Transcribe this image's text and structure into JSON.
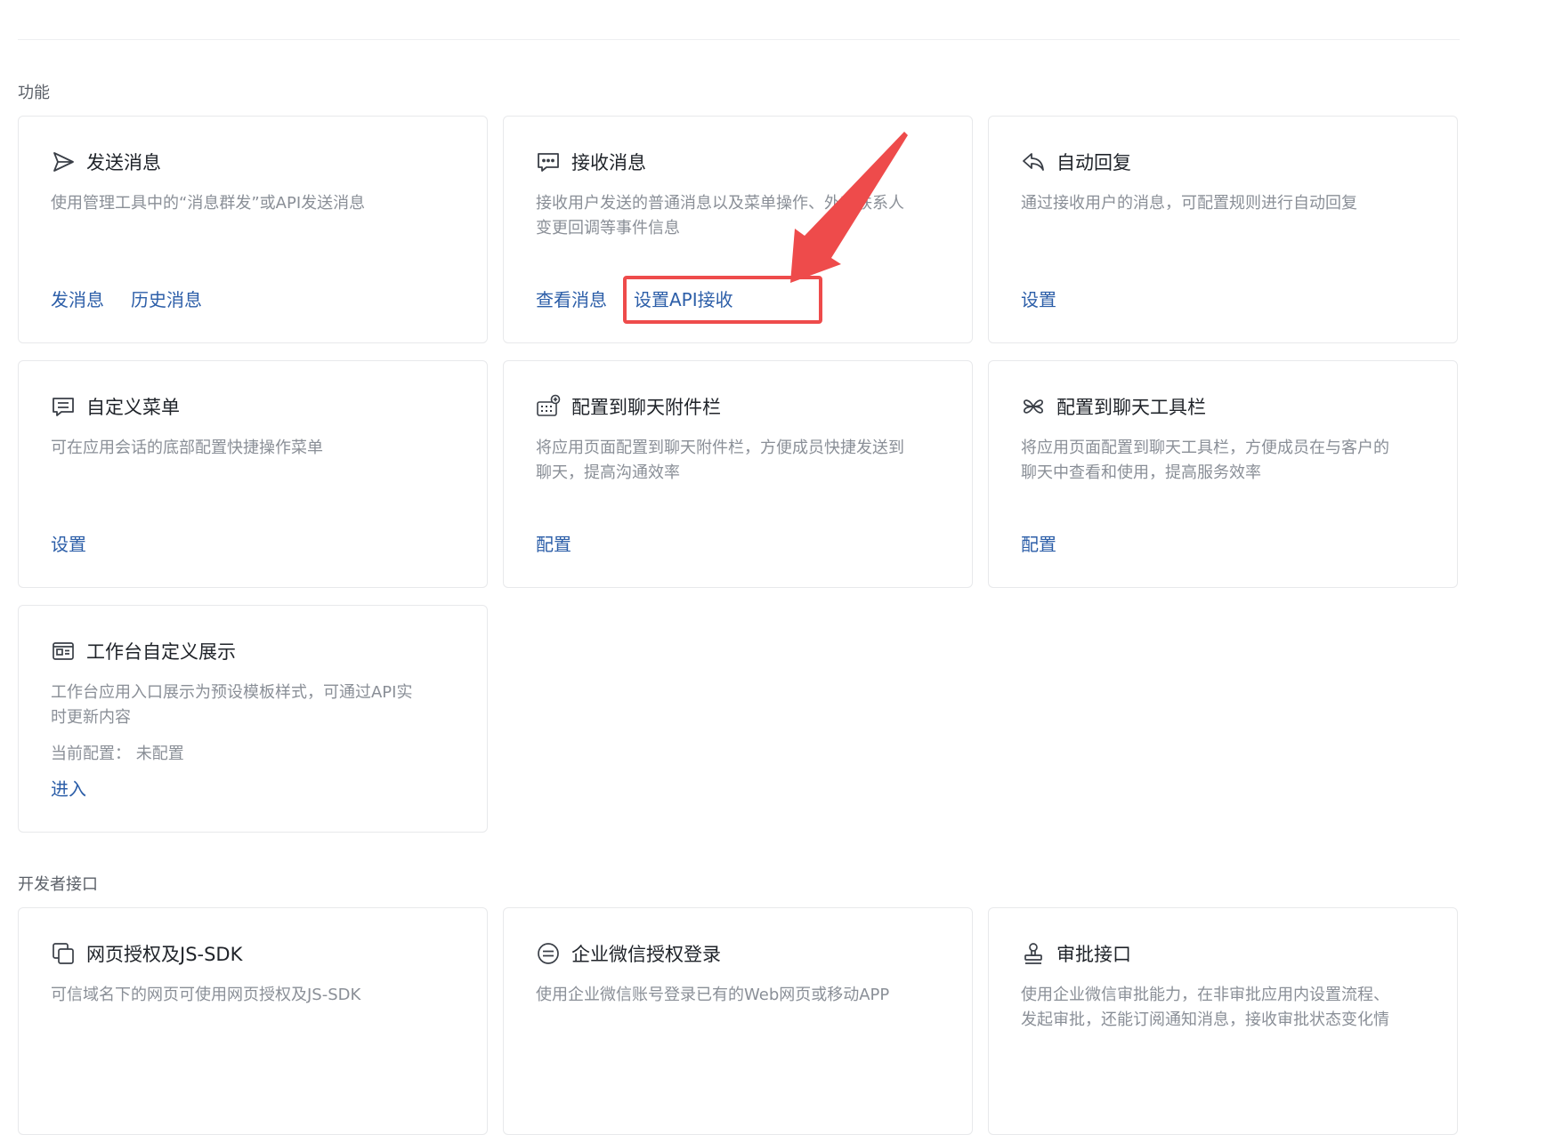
{
  "sections": {
    "features": "功能",
    "developer": "开发者接口"
  },
  "cards": {
    "send": {
      "title": "发送消息",
      "desc": [
        "使用管理工具中的“消息群发”或API发送消息"
      ],
      "links": [
        "发消息",
        "历史消息"
      ],
      "icon": "send-icon"
    },
    "receive": {
      "title": "接收消息",
      "desc": [
        "接收用户发送的普通消息以及菜单操作、外部联系人",
        "变更回调等事件信息"
      ],
      "links": [
        "查看消息",
        "设置API接收"
      ],
      "icon": "message-icon"
    },
    "autoreply": {
      "title": "自动回复",
      "desc": [
        "通过接收用户的消息，可配置规则进行自动回复"
      ],
      "links": [
        "设置"
      ],
      "icon": "reply-icon"
    },
    "menu": {
      "title": "自定义菜单",
      "desc": [
        "可在应用会话的底部配置快捷操作菜单"
      ],
      "links": [
        "设置"
      ],
      "icon": "menu-icon"
    },
    "attachbar": {
      "title": "配置到聊天附件栏",
      "desc": [
        "将应用页面配置到聊天附件栏，方便成员快捷发送到",
        "聊天，提高沟通效率"
      ],
      "links": [
        "配置"
      ],
      "icon": "keyboard-add-icon"
    },
    "toolbar": {
      "title": "配置到聊天工具栏",
      "desc": [
        "将应用页面配置到聊天工具栏，方便成员在与客户的",
        "聊天中查看和使用，提高服务效率"
      ],
      "links": [
        "配置"
      ],
      "icon": "toolbar-icon"
    },
    "workbench": {
      "title": "工作台自定义展示",
      "desc": [
        "工作台应用入口展示为预设模板样式，可通过API实",
        "时更新内容"
      ],
      "extra": "当前配置：  未配置",
      "links": [
        "进入"
      ],
      "icon": "template-icon"
    },
    "jssdk": {
      "title": "网页授权及JS-SDK",
      "desc": [
        "可信域名下的网页可使用网页授权及JS-SDK"
      ],
      "icon": "copy-icon"
    },
    "login": {
      "title": "企业微信授权登录",
      "desc": [
        "使用企业微信账号登录已有的Web网页或移动APP"
      ],
      "icon": "equal-circle-icon"
    },
    "approval": {
      "title": "审批接口",
      "desc": [
        "使用企业微信审批能力，在非审批应用内设置流程、",
        "发起审批，还能订阅通知消息，接收审批状态变化情"
      ],
      "icon": "stamp-icon"
    }
  },
  "colors": {
    "link": "#2c5ea8",
    "annotation": "#ee4b4b"
  }
}
